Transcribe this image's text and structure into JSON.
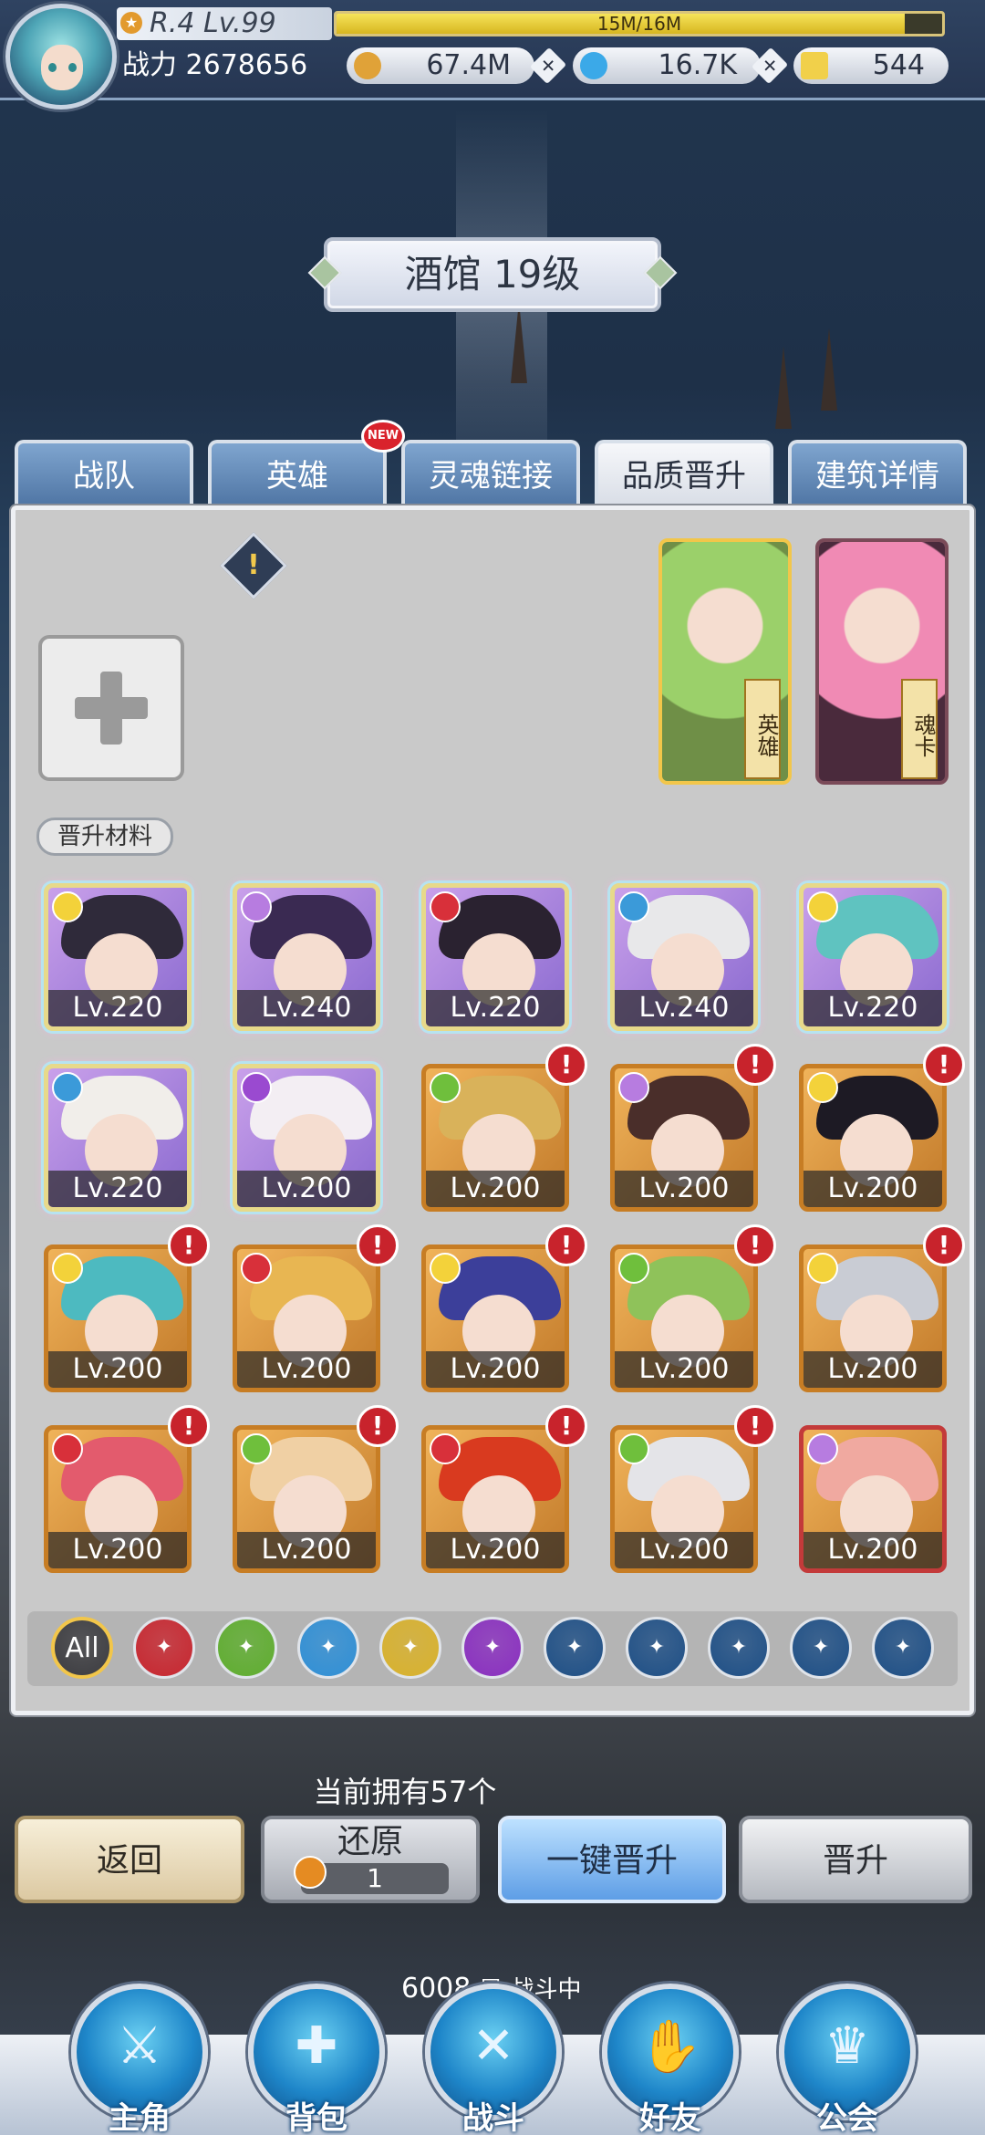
{
  "header": {
    "rank_level": "R.4 Lv.99",
    "exp_text": "15M/16M",
    "exp_fraction": 0.9375,
    "power_label": "战力",
    "power_value": "2678656",
    "resources": [
      {
        "name": "gold",
        "icon": "coin-icon",
        "value": "67.4M",
        "color": "#e0a238"
      },
      {
        "name": "diamond",
        "icon": "diamond-icon",
        "value": "16.7K",
        "color": "#3ba9e8"
      },
      {
        "name": "crystal",
        "icon": "crystal-icon",
        "value": "544",
        "color": "#f1d04a"
      }
    ]
  },
  "building_title": "酒馆 19级",
  "tabs": [
    {
      "label": "战队",
      "active": false
    },
    {
      "label": "英雄",
      "active": false,
      "badge": "NEW"
    },
    {
      "label": "灵魂链接",
      "active": false
    },
    {
      "label": "品质晋升",
      "active": true
    },
    {
      "label": "建筑详情",
      "active": false
    }
  ],
  "promotion": {
    "warning_icon": "!",
    "card_hero_label": "英雄",
    "card_soul_label": "魂卡",
    "materials_label": "晋升材料"
  },
  "heroes": [
    {
      "level": "Lv.220",
      "element": "wind",
      "frame": "rainbow",
      "hair": "#2f2a3a",
      "alert": false
    },
    {
      "level": "Lv.240",
      "element": "arcane",
      "frame": "rainbow",
      "hair": "#3a2a52",
      "alert": false
    },
    {
      "level": "Lv.220",
      "element": "fire",
      "frame": "rainbow",
      "hair": "#2a2230",
      "alert": false
    },
    {
      "level": "Lv.240",
      "element": "water",
      "frame": "rainbow",
      "hair": "#e8e8ea",
      "alert": false
    },
    {
      "level": "Lv.220",
      "element": "light",
      "frame": "rainbow",
      "hair": "#5fc3c0",
      "alert": false
    },
    {
      "level": "Lv.220",
      "element": "water",
      "frame": "rainbow",
      "hair": "#f1eeea",
      "alert": false
    },
    {
      "level": "Lv.200",
      "element": "dark",
      "frame": "rainbow",
      "hair": "#f3eef3",
      "alert": false
    },
    {
      "level": "Lv.200",
      "element": "earth",
      "frame": "gold",
      "hair": "#d9b25a",
      "alert": true
    },
    {
      "level": "Lv.200",
      "element": "arcane",
      "frame": "gold",
      "hair": "#4a2e2a",
      "alert": true
    },
    {
      "level": "Lv.200",
      "element": "shadow",
      "frame": "gold",
      "hair": "#1d1a24",
      "alert": true
    },
    {
      "level": "Lv.200",
      "element": "light",
      "frame": "gold",
      "hair": "#4dbac0",
      "alert": true
    },
    {
      "level": "Lv.200",
      "element": "fire",
      "frame": "gold",
      "hair": "#e8b652",
      "alert": true
    },
    {
      "level": "Lv.200",
      "element": "light",
      "frame": "gold",
      "hair": "#3c3f9a",
      "alert": true
    },
    {
      "level": "Lv.200",
      "element": "earth",
      "frame": "gold",
      "hair": "#8fc25a",
      "alert": true
    },
    {
      "level": "Lv.200",
      "element": "light",
      "frame": "gold",
      "hair": "#c9ccd4",
      "alert": true
    },
    {
      "level": "Lv.200",
      "element": "fire",
      "frame": "gold",
      "hair": "#e35b6d",
      "alert": true
    },
    {
      "level": "Lv.200",
      "element": "earth",
      "frame": "gold",
      "hair": "#f0d0a4",
      "alert": true
    },
    {
      "level": "Lv.200",
      "element": "fire",
      "frame": "gold",
      "hair": "#d93a1f",
      "alert": true
    },
    {
      "level": "Lv.200",
      "element": "earth",
      "frame": "gold",
      "hair": "#e4e4e8",
      "alert": true
    },
    {
      "level": "Lv.200",
      "element": "arcane",
      "frame": "red",
      "hair": "#f0a9a0",
      "alert": false
    }
  ],
  "filters": [
    {
      "name": "all",
      "label": "All",
      "color": "#3c3c40",
      "icon": "all-icon"
    },
    {
      "name": "fire",
      "label": "",
      "color": "#c8262f",
      "icon": "fire-element-icon"
    },
    {
      "name": "earth",
      "label": "",
      "color": "#5fae2f",
      "icon": "earth-element-icon"
    },
    {
      "name": "water",
      "label": "",
      "color": "#2f8fd6",
      "icon": "water-element-icon"
    },
    {
      "name": "light",
      "label": "",
      "color": "#d9b22c",
      "icon": "light-element-icon"
    },
    {
      "name": "dark",
      "label": "",
      "color": "#8a2fc0",
      "icon": "dark-element-icon"
    },
    {
      "name": "class1",
      "label": "",
      "color": "#1e4f86",
      "icon": "sword-class-icon"
    },
    {
      "name": "class2",
      "label": "",
      "color": "#1e4f86",
      "icon": "swirl-class-icon"
    },
    {
      "name": "class3",
      "label": "",
      "color": "#1e4f86",
      "icon": "staff-class-icon"
    },
    {
      "name": "class4",
      "label": "",
      "color": "#1e4f86",
      "icon": "shield-class-icon"
    },
    {
      "name": "class5",
      "label": "",
      "color": "#1e4f86",
      "icon": "wing-class-icon"
    }
  ],
  "owned_text": "当前拥有57个",
  "buttons": {
    "back": "返回",
    "restore": "还原",
    "restore_count": "1",
    "one_click_promote": "一键晋升",
    "promote": "晋升"
  },
  "status": {
    "floor": "6008",
    "floor_unit": "层",
    "battle_state": "战斗中"
  },
  "nav": [
    {
      "label": "主角",
      "icon": "helmet-icon",
      "glyph": "⚔"
    },
    {
      "label": "背包",
      "icon": "backpack-icon",
      "glyph": "✚"
    },
    {
      "label": "战斗",
      "icon": "crossed-swords-icon",
      "glyph": "✕"
    },
    {
      "label": "好友",
      "icon": "handshake-icon",
      "glyph": "✋"
    },
    {
      "label": "公会",
      "icon": "guild-crest-icon",
      "glyph": "♛"
    }
  ]
}
